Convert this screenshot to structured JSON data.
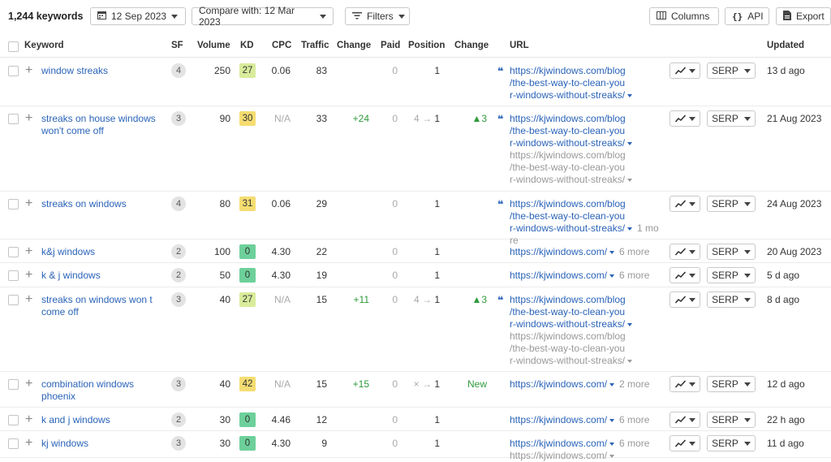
{
  "toolbar": {
    "keyword_count": "1,244 keywords",
    "date": "12 Sep 2023",
    "compare": "Compare with: 12 Mar 2023",
    "filters": "Filters",
    "columns": "Columns",
    "api": "API",
    "export": "Export"
  },
  "headers": {
    "keyword": "Keyword",
    "sf": "SF",
    "volume": "Volume",
    "kd": "KD",
    "cpc": "CPC",
    "traffic": "Traffic",
    "change": "Change",
    "paid": "Paid",
    "position": "Position",
    "change2": "Change",
    "url": "URL",
    "updated": "Updated"
  },
  "serp_label": "SERP",
  "kd_colors": {
    "light_yellow": "#d9ec9b",
    "yellow": "#f5dd72",
    "green": "#6dd09a"
  },
  "rows": [
    {
      "keyword": "window streaks",
      "sf": "4",
      "volume": "250",
      "kd": "27",
      "cpc": "0.06",
      "traffic": "83",
      "change": "",
      "paid": "0",
      "pos_from": "",
      "position": "1",
      "pos_change": "",
      "url_quote": true,
      "url": "https://kjwindows.com/blog/the-best-way-to-clean-your-windows-without-streaks/",
      "old_url": "",
      "more": "",
      "updated": "13 d ago"
    },
    {
      "keyword": "streaks on house windows won't come off",
      "sf": "3",
      "volume": "90",
      "kd": "30",
      "cpc": "N/A",
      "traffic": "33",
      "change": "+24",
      "paid": "0",
      "pos_from": "4",
      "position": "1",
      "pos_change": "▲3",
      "url_quote": true,
      "url": "https://kjwindows.com/blog/the-best-way-to-clean-your-windows-without-streaks/",
      "old_url": "https://kjwindows.com/blog/the-best-way-to-clean-your-windows-without-streaks/",
      "more": "",
      "updated": "21 Aug 2023"
    },
    {
      "keyword": "streaks on windows",
      "sf": "4",
      "volume": "80",
      "kd": "31",
      "cpc": "0.06",
      "traffic": "29",
      "change": "",
      "paid": "0",
      "pos_from": "",
      "position": "1",
      "pos_change": "",
      "url_quote": true,
      "url": "https://kjwindows.com/blog/the-best-way-to-clean-your-windows-without-streaks/",
      "old_url": "",
      "more": "1 more",
      "updated": "24 Aug 2023"
    },
    {
      "keyword": "k&j windows",
      "sf": "2",
      "volume": "100",
      "kd": "0",
      "cpc": "4.30",
      "traffic": "22",
      "change": "",
      "paid": "0",
      "pos_from": "",
      "position": "1",
      "pos_change": "",
      "url_quote": false,
      "url": "https://kjwindows.com/",
      "old_url": "",
      "more": "6 more",
      "updated": "20 Aug 2023"
    },
    {
      "keyword": "k & j windows",
      "sf": "2",
      "volume": "50",
      "kd": "0",
      "cpc": "4.30",
      "traffic": "19",
      "change": "",
      "paid": "0",
      "pos_from": "",
      "position": "1",
      "pos_change": "",
      "url_quote": false,
      "url": "https://kjwindows.com/",
      "old_url": "",
      "more": "6 more",
      "updated": "5 d ago"
    },
    {
      "keyword": "streaks on windows won t come off",
      "sf": "3",
      "volume": "40",
      "kd": "27",
      "cpc": "N/A",
      "traffic": "15",
      "change": "+11",
      "paid": "0",
      "pos_from": "4",
      "position": "1",
      "pos_change": "▲3",
      "url_quote": true,
      "url": "https://kjwindows.com/blog/the-best-way-to-clean-your-windows-without-streaks/",
      "old_url": "https://kjwindows.com/blog/the-best-way-to-clean-your-windows-without-streaks/",
      "more": "",
      "updated": "8 d ago"
    },
    {
      "keyword": "combination windows phoenix",
      "sf": "3",
      "volume": "40",
      "kd": "42",
      "cpc": "N/A",
      "traffic": "15",
      "change": "+15",
      "paid": "0",
      "pos_from": "×",
      "position": "1",
      "pos_change": "New",
      "url_quote": false,
      "url": "https://kjwindows.com/",
      "old_url": "",
      "more": "2 more",
      "updated": "12 d ago"
    },
    {
      "keyword": "k and j windows",
      "sf": "2",
      "volume": "30",
      "kd": "0",
      "cpc": "4.46",
      "traffic": "12",
      "change": "",
      "paid": "0",
      "pos_from": "",
      "position": "1",
      "pos_change": "",
      "url_quote": false,
      "url": "https://kjwindows.com/",
      "old_url": "",
      "more": "6 more",
      "updated": "22 h ago"
    },
    {
      "keyword": "kj windows",
      "sf": "3",
      "volume": "30",
      "kd": "0",
      "cpc": "4.30",
      "traffic": "9",
      "change": "",
      "paid": "0",
      "pos_from": "",
      "position": "1",
      "pos_change": "",
      "url_quote": false,
      "url": "https://kjwindows.com/",
      "old_url": "https://kjwindows.com/",
      "more": "6 more",
      "updated": "11 d ago"
    }
  ]
}
